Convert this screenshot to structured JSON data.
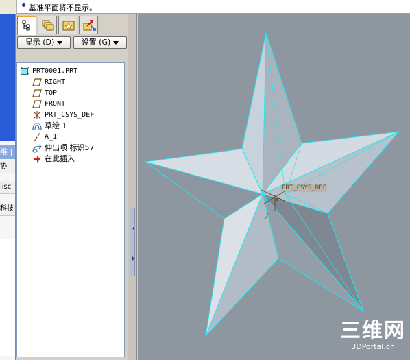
{
  "status": {
    "message": "基准平面将不显示。"
  },
  "background_window": {
    "title_fragment": "维 |",
    "row1": "协",
    "row2": "iisc",
    "row3": "科技"
  },
  "panel": {
    "tabs": [
      {
        "icon": "model-tree-icon",
        "active": true
      },
      {
        "icon": "layers-icon",
        "active": false
      },
      {
        "icon": "favorites-icon",
        "active": false
      },
      {
        "icon": "navigator-icon",
        "active": false
      }
    ],
    "show_menu": "显示 (D)",
    "settings_menu": "设置 (G)"
  },
  "tree": {
    "items": [
      {
        "label": "PRT0001.PRT",
        "icon": "part-icon"
      },
      {
        "label": "RIGHT",
        "icon": "datum-plane-icon"
      },
      {
        "label": "TOP",
        "icon": "datum-plane-icon"
      },
      {
        "label": "FRONT",
        "icon": "datum-plane-icon"
      },
      {
        "label": "PRT_CSYS_DEF",
        "icon": "coordinate-system-icon"
      },
      {
        "label": "草绘 1",
        "icon": "sketch-icon"
      },
      {
        "label": "A_1",
        "icon": "datum-axis-icon"
      },
      {
        "label": "伸出项 标识57",
        "icon": "protrusion-icon"
      },
      {
        "label": "在此插入",
        "icon": "insert-here-arrow-icon"
      }
    ]
  },
  "viewport": {
    "csys_label": "PRT_CSYS_DEF",
    "edge_color": "#22e6f0",
    "face_light": "#d6dde4",
    "face_dark": "#8c96a0",
    "background": "#8e969f"
  },
  "watermark": {
    "logo": "三维网",
    "url": "3DPortal.cn"
  }
}
